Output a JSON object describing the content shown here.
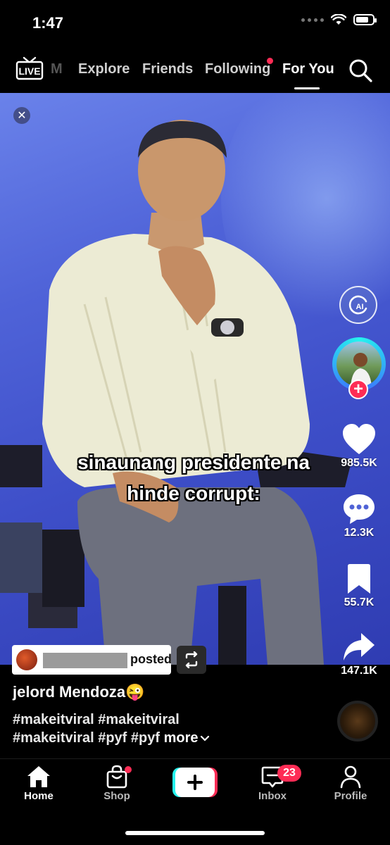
{
  "status": {
    "time": "1:47",
    "battery_level": 0.75
  },
  "top_nav": {
    "live_label": "LIVE",
    "tabs": [
      {
        "label": "M"
      },
      {
        "label": "Explore"
      },
      {
        "label": "Friends"
      },
      {
        "label": "Following"
      },
      {
        "label": "For You"
      }
    ],
    "active_tab": "For You",
    "search_icon": "search-icon"
  },
  "video": {
    "caption_lines": [
      "sinaunang presidente na",
      "hinde corrupt:"
    ],
    "close_symbol": "✕"
  },
  "actions": {
    "ai_label": "AI",
    "likes": "985.5K",
    "comments": "12.3K",
    "saves": "55.7K",
    "shares": "147.1K"
  },
  "post": {
    "reposted_text": "posted",
    "username": "jelord Mendoza😜",
    "description_line1": "#makeitviral #makeitviral",
    "description_line2": "#makeitviral #pyf #pyf",
    "more_label": "more"
  },
  "bottom_nav": {
    "items": [
      {
        "label": "Home"
      },
      {
        "label": "Shop"
      },
      {
        "label": "Inbox"
      },
      {
        "label": "Profile"
      }
    ],
    "inbox_badge": "23"
  },
  "colors": {
    "accent": "#fe2c55",
    "cyan": "#25f4ee",
    "background": "#000000"
  }
}
